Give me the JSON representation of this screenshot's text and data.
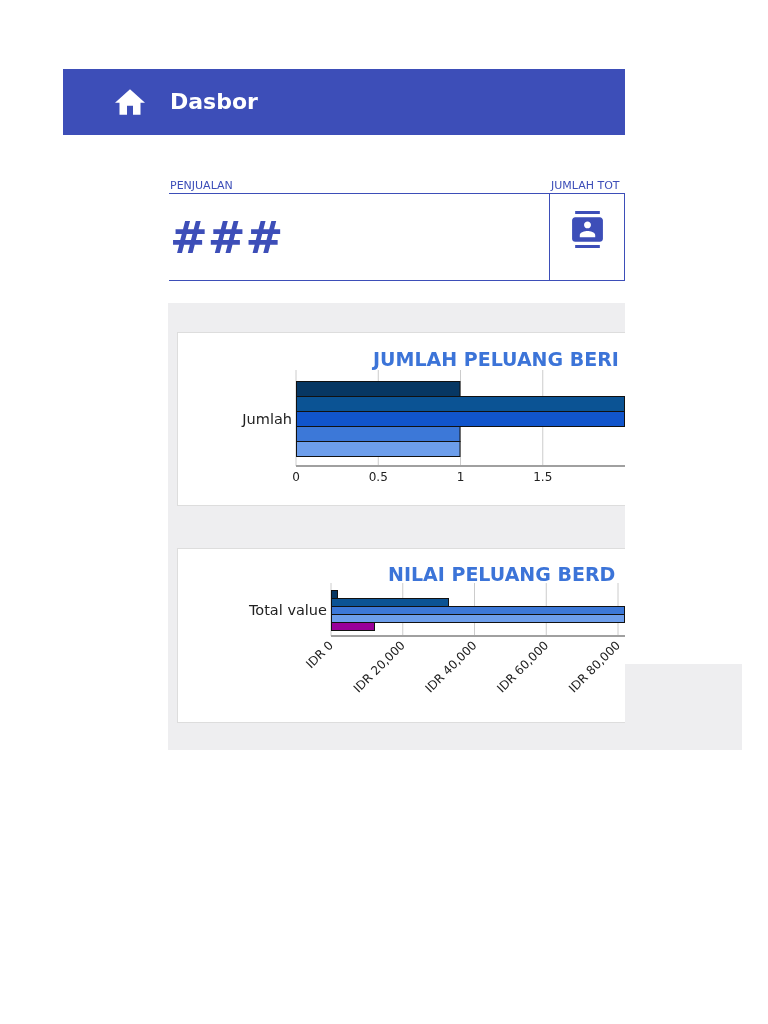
{
  "header": {
    "title": "Dasbor"
  },
  "stats": [
    {
      "kind": "value",
      "label": "PENJUALAN",
      "value": "###"
    },
    {
      "kind": "icon",
      "label": "JUMLAH TOT"
    }
  ],
  "count_chart": {
    "chart_data": {
      "type": "bar",
      "orientation": "horizontal",
      "title": "JUMLAH PELUANG BERI",
      "categories": [
        "Jumlah"
      ],
      "series": [
        {
          "color": "#073763",
          "values": [
            1
          ]
        },
        {
          "color": "#0b5394",
          "values": [
            2
          ]
        },
        {
          "color": "#1155cc",
          "values": [
            2
          ]
        },
        {
          "color": "#3c78d8",
          "values": [
            1
          ]
        },
        {
          "color": "#6d9eeb",
          "values": [
            1
          ]
        }
      ],
      "xlim": [
        0,
        2
      ],
      "xticks": [
        0,
        0.5,
        1,
        1.5
      ],
      "grid": true
    }
  },
  "value_chart": {
    "title": "NILAI PELUANG BERD",
    "category": "Total value",
    "bars": [
      {
        "color": "#073763"
      },
      {
        "color": "#0b5394"
      },
      {
        "color": "#3c78d8"
      },
      {
        "color": "#6d9eeb"
      },
      {
        "color": "#990099"
      }
    ],
    "tick_labels": [
      "IDR 0",
      "IDR 20,000",
      "IDR 40,000",
      "IDR 60,000",
      "IDR 80,000"
    ]
  }
}
